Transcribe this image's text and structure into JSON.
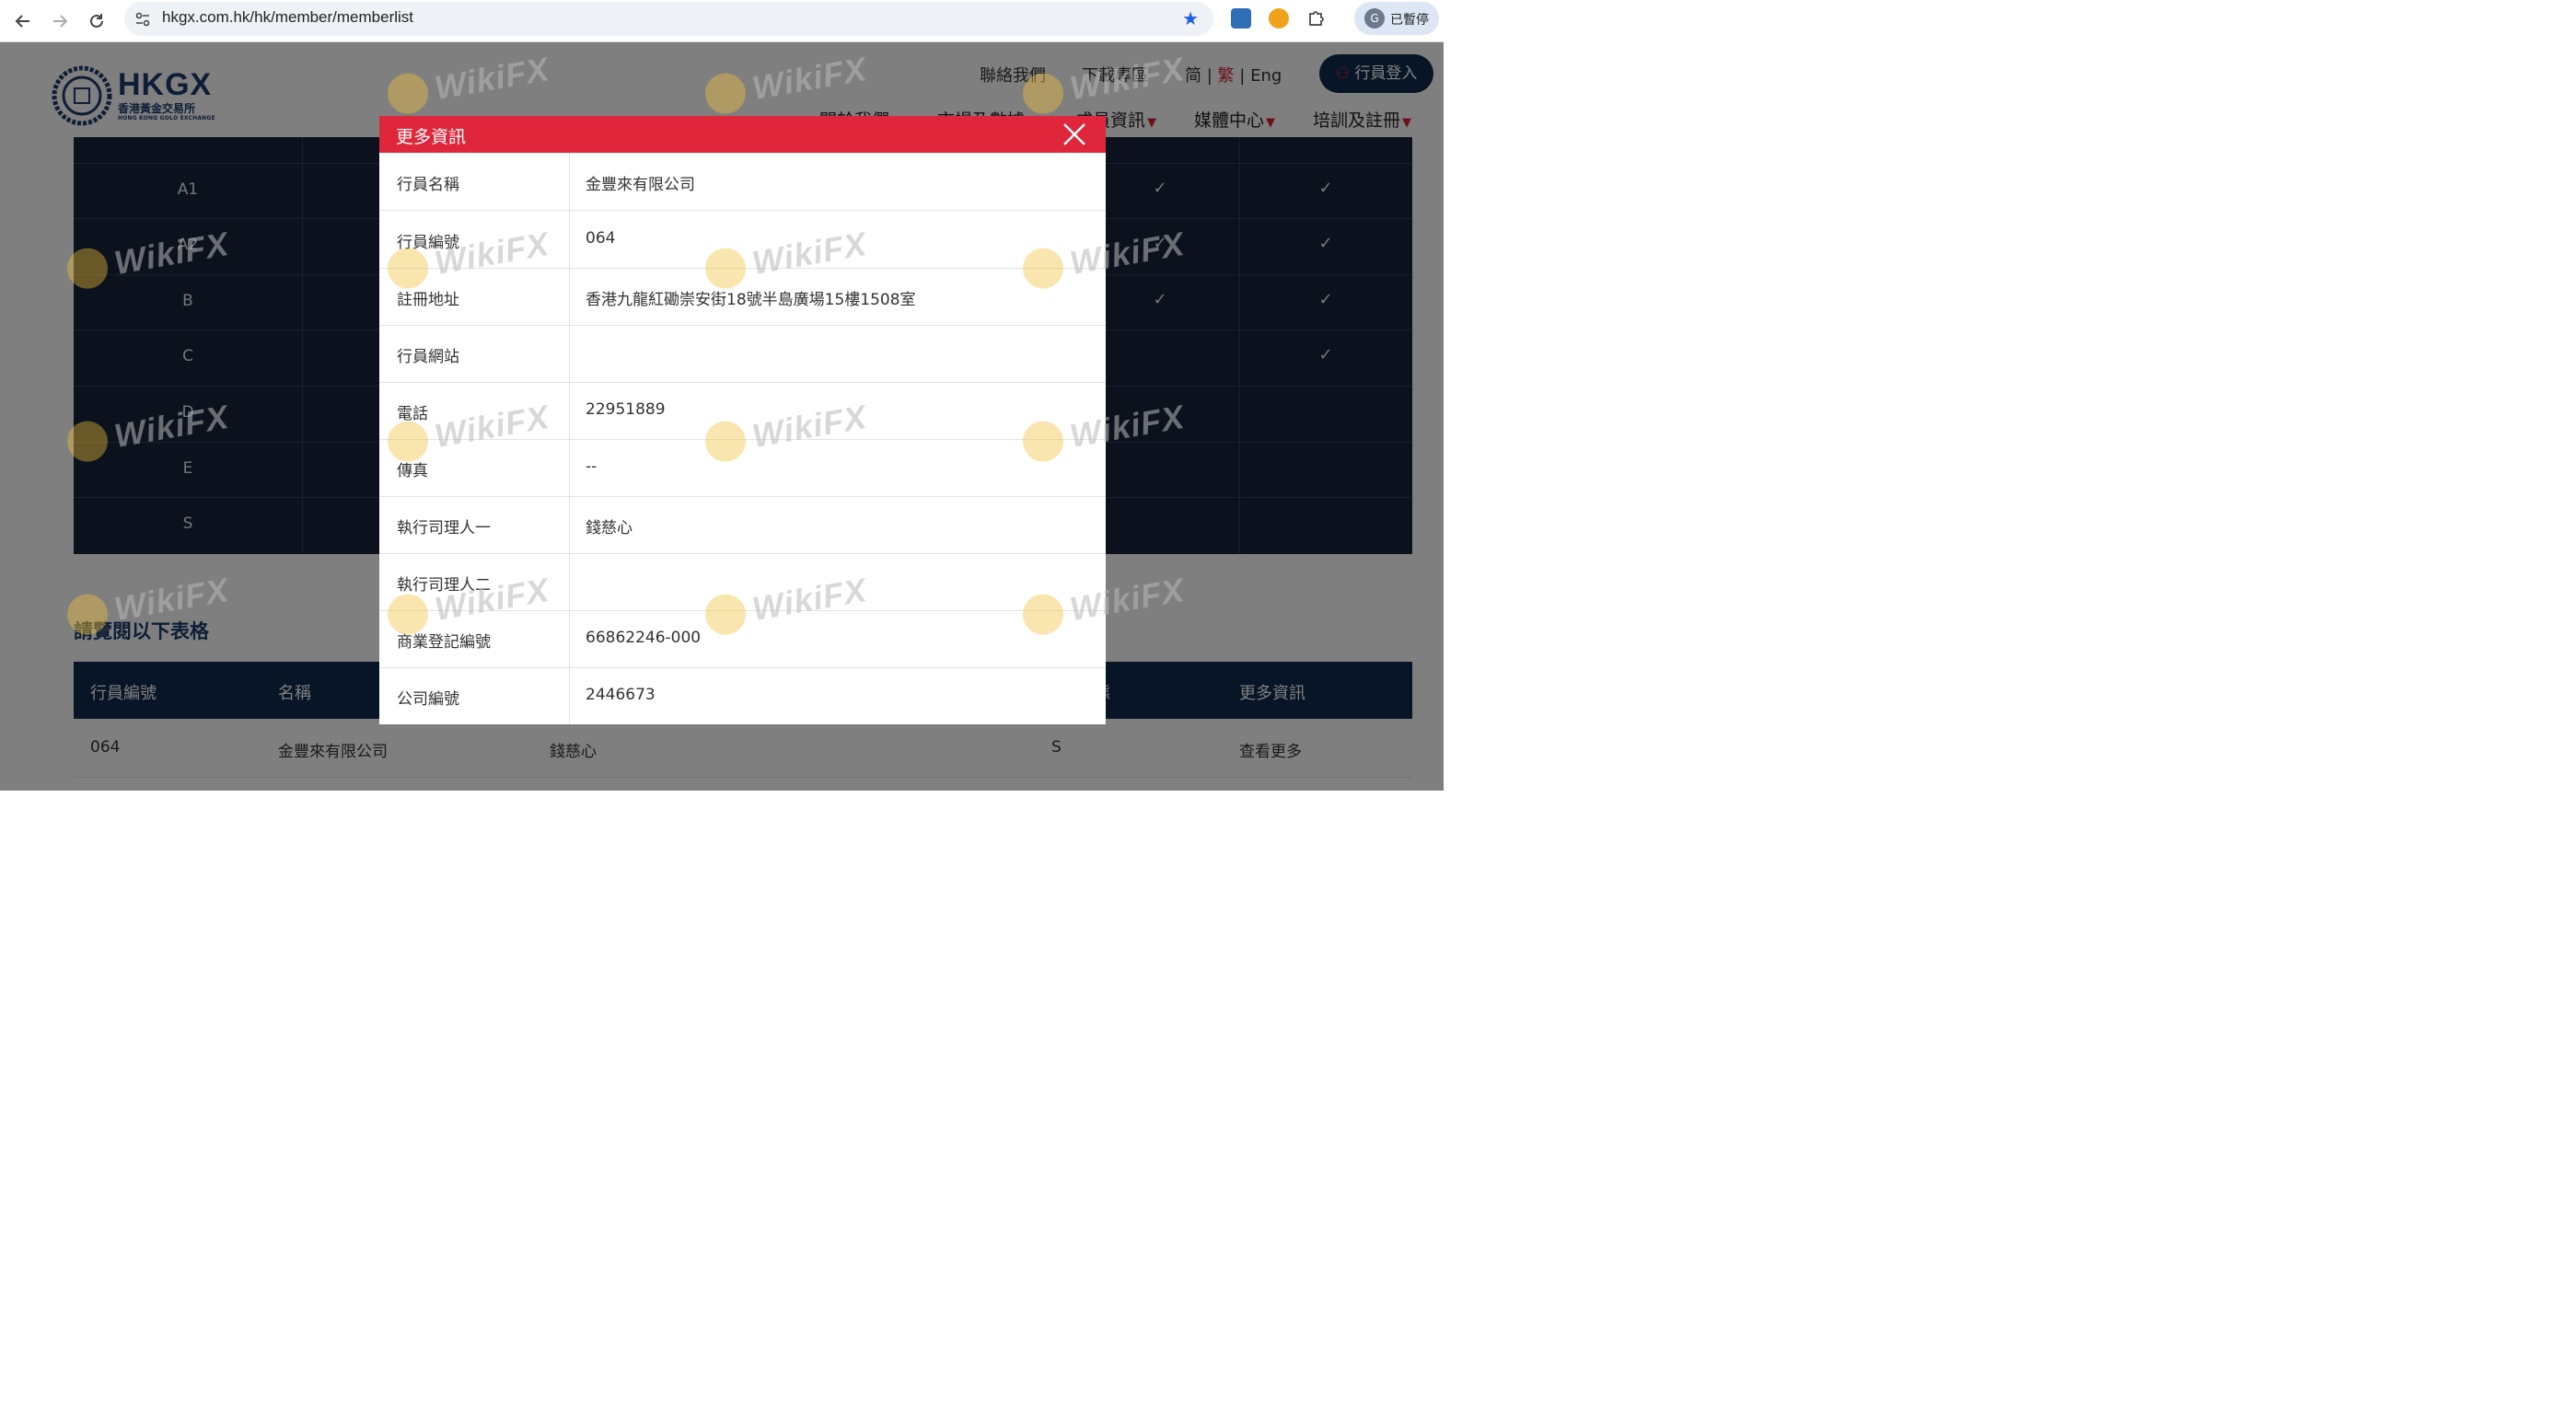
{
  "browser": {
    "url": "hkgx.com.hk/hk/member/memberlist",
    "profile_initial": "G",
    "profile_status": "已暫停"
  },
  "site": {
    "brand": "HKGX",
    "brand_cn": "香港黃金交易所",
    "brand_en": "HONG KONG GOLD EXCHANGE",
    "top_links": [
      "聯絡我們",
      "下載專區"
    ],
    "lang": {
      "simplified": "简",
      "traditional": "繁",
      "english": "Eng",
      "sep": "|"
    },
    "login_label": "行員登入",
    "menu": [
      "關於我們",
      "市場及數據",
      "成員資訊",
      "媒體中心",
      "培訓及註冊"
    ]
  },
  "tier_table": {
    "rows": [
      {
        "label": "A1",
        "c1": "✓",
        "c2": "✓"
      },
      {
        "label": "A2",
        "c1": "✓",
        "c2": "✓"
      },
      {
        "label": "B",
        "c1": "✓",
        "c2": "✓"
      },
      {
        "label": "C",
        "c1": "",
        "c2": "✓"
      },
      {
        "label": "D",
        "c1": "",
        "c2": ""
      },
      {
        "label": "E",
        "c1": "",
        "c2": ""
      },
      {
        "label": "S",
        "c1": "",
        "c2": ""
      }
    ]
  },
  "list": {
    "section_title": "請覽閱以下表格",
    "headers": [
      "行員編號",
      "名稱",
      "態",
      "更多資訊"
    ],
    "row": {
      "member_no": "064",
      "name": "金豐來有限公司",
      "officer": "錢慈心",
      "category": "S",
      "more": "查看更多"
    }
  },
  "modal": {
    "title": "更多資訊",
    "rows": [
      {
        "key": "行員名稱",
        "value": "金豐來有限公司"
      },
      {
        "key": "行員編號",
        "value": "064"
      },
      {
        "key": "註冊地址",
        "value": "香港九龍紅磡崇安街18號半島廣場15樓1508室"
      },
      {
        "key": "行員網站",
        "value": ""
      },
      {
        "key": "電話",
        "value": "22951889"
      },
      {
        "key": "傳真",
        "value": "--"
      },
      {
        "key": "執行司理人一",
        "value": "錢慈心"
      },
      {
        "key": "執行司理人二",
        "value": ""
      },
      {
        "key": "商業登記編號",
        "value": "66862246-000"
      },
      {
        "key": "公司編號",
        "value": "2446673"
      }
    ]
  },
  "watermark": {
    "text": "WikiFX"
  },
  "colors": {
    "modal_header": "#e0263a",
    "navy": "#0e2a4d",
    "accent_red": "#d9252e"
  }
}
